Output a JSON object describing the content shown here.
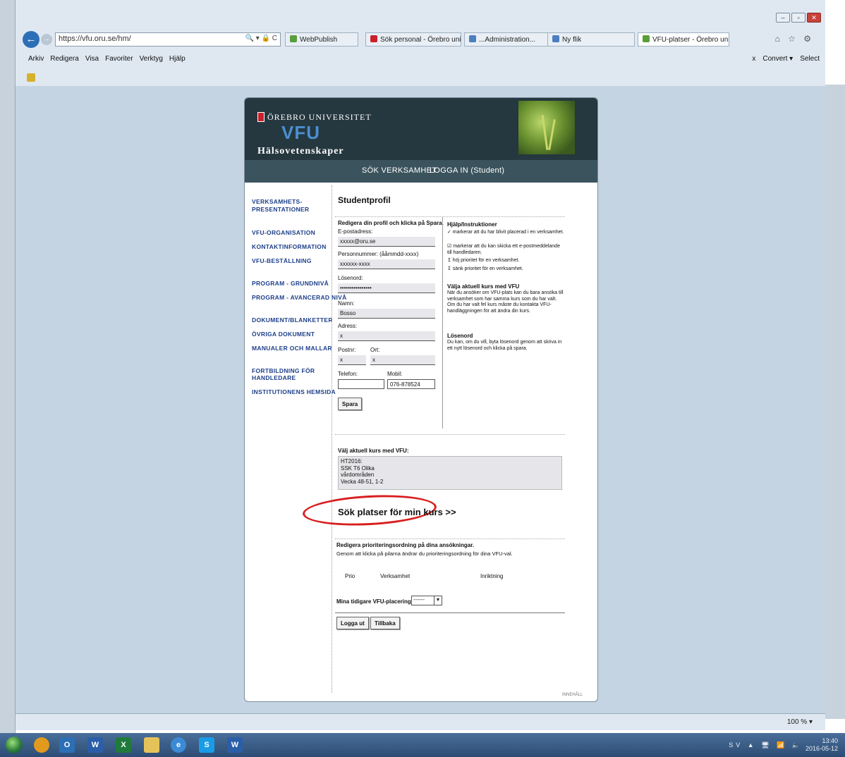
{
  "browser": {
    "url": "https://vfu.oru.se/hm/",
    "address_controls": "🔍 ▾ 🔒 C",
    "tabs": [
      {
        "label": "WebPublish",
        "fav_color": "#5a9e3a"
      },
      {
        "label": "Sök personal - Örebro universi...",
        "fav_color": "#c9202b"
      },
      {
        "label": "...Administration...",
        "fav_color": "#4d7fc0"
      },
      {
        "label": "Ny flik",
        "fav_color": "#4d7fc0"
      },
      {
        "label": "VFU-platser - Örebro univer...",
        "fav_color": "#5a9e3a"
      }
    ],
    "tab_close": "x",
    "menu": [
      "Arkiv",
      "Redigera",
      "Visa",
      "Favoriter",
      "Verktyg",
      "Hjälp"
    ],
    "toolbar_right": [
      "x",
      "Convert ▾",
      "Select"
    ],
    "nav_right_icons": "⌂ ☆ ⚙",
    "zoom": "100 % ▾"
  },
  "site": {
    "university": "ÖREBRO UNIVERSITET",
    "title": "VFU",
    "department": "Hälsovetenskaper",
    "nav": [
      "SÖK VERKSAMHET",
      "LOGGA IN (Student)"
    ],
    "sidenav": [
      "VERKSAMHETS-",
      "PRESENTATIONER",
      "VFU-ORGANISATION",
      "KONTAKTINFORMATION",
      "VFU-BESTÄLLNING",
      "PROGRAM - GRUNDNIVÅ",
      "PROGRAM - AVANCERAD NIVÅ",
      "DOKUMENT/BLANKETTER",
      "ÖVRIGA DOKUMENT",
      "MANUALER OCH MALLAR",
      "FORTBILDNING FÖR",
      "HANDLEDARE",
      "INSTITUTIONENS HEMSIDA"
    ],
    "footer": "INNEHÅLL"
  },
  "profile": {
    "title": "Studentprofil",
    "intro": "Redigera din profil och klicka på Spara.",
    "fields": {
      "email_label": "E-postadress:",
      "email_value": "xxxxx@oru.se",
      "pnr_label": "Personnummer: (ååmmdd-xxxx)",
      "pnr_value": "xxxxxx-xxxx",
      "password_label": "Lösenord:",
      "password_value": "••••••••••••••••",
      "name_label": "Namn:",
      "name_value": "Bosso",
      "address_label": "Adress:",
      "address_value": "x",
      "zip_label": "Postnr:",
      "zip_value": "x",
      "city_label": "Ort:",
      "city_value": "x",
      "phone_label": "Telefon:",
      "phone_value": "",
      "mobile_label": "Mobil:",
      "mobile_value": "076-878524"
    },
    "save_button": "Spara",
    "help": {
      "title": "Hjälp/Instruktioner",
      "line1": "✓ markerar att du har blivit placerad i en verksamhet.",
      "line2": "☑ markerar att du kan skicka ett e-postmeddelande till handledaren.",
      "line3": "↥ höj prioritet för en verksamhet.",
      "line4": "↧ sänk prioritet för en verksamhet.",
      "kurs_title": "Välja aktuell kurs med VFU",
      "kurs_text": "När du ansöker om VFU-plats kan du bara ansöka till verksamhet som har samma kurs som du har valt. Om du har valt fel kurs måste du kontakta VFU-handläggningen för att ändra din kurs.",
      "pw_title": "Lösenord",
      "pw_text": "Du kan, om du vill, byta lösenord genom att skriva in ett nytt lösenord och klicka på spara."
    }
  },
  "kurs": {
    "label": "Välj aktuell kurs med VFU:",
    "lines": [
      "HT2016:",
      "SSK T6 Olika",
      "vårdområden",
      "Vecka 48-51, 1-2"
    ],
    "search_link": "Sök platser för min kurs >>"
  },
  "priority": {
    "title": "Redigera prioriteringsordning på dina ansökningar.",
    "desc": "Genom att klicka på pilarna ändrar du prioriteringsordning för dina VFU-val.",
    "col_prio": "Prio",
    "col_verksamhet": "Verksamhet",
    "col_inriktning": "Inriktning",
    "previous_label": "Mina tidigare VFU-placeringar",
    "previous_value": "------",
    "logout": "Logga ut",
    "back": "Tillbaka"
  },
  "taskbar": {
    "tray_lang": "SV",
    "tray_icons": "▲ 🖥 📶 🔈",
    "time": "13:40",
    "date": "2016-05-12"
  },
  "colors": {
    "header": "#25373f",
    "nav": "#3b535d",
    "link": "#1d3f8a",
    "highlight_oval": "#d81e1e",
    "page_bg": "#c4d4e2"
  }
}
